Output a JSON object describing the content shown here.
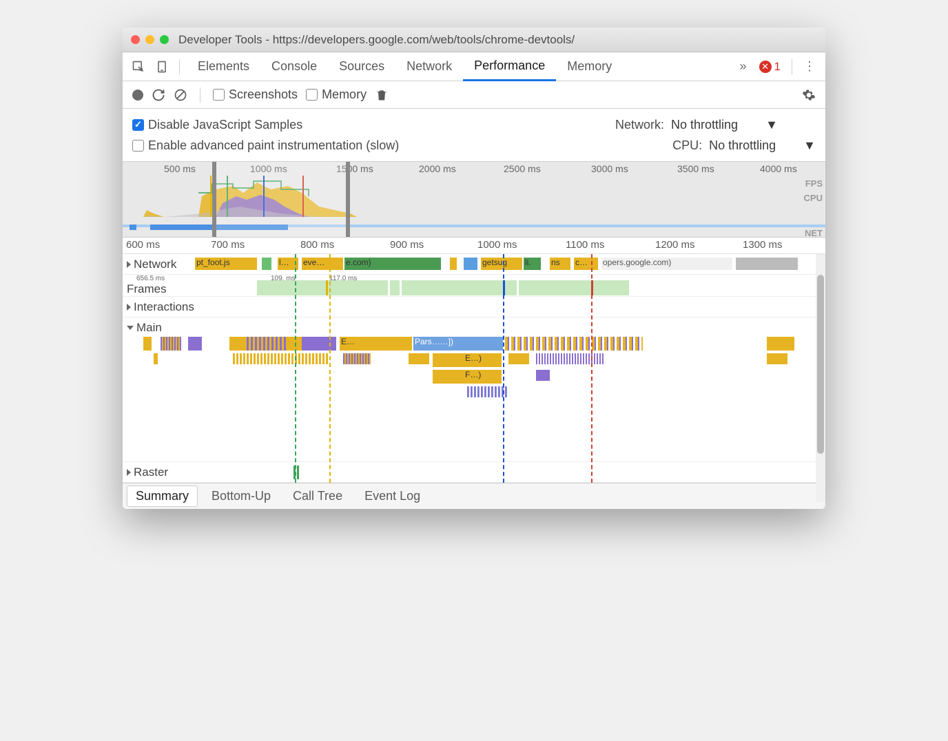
{
  "window": {
    "title": "Developer Tools - https://developers.google.com/web/tools/chrome-devtools/"
  },
  "tabs": {
    "items": [
      "Elements",
      "Console",
      "Sources",
      "Network",
      "Performance",
      "Memory"
    ],
    "active": "Performance",
    "overflow": "»",
    "errors": "1"
  },
  "toolbar": {
    "screenshots": "Screenshots",
    "memory": "Memory"
  },
  "settings": {
    "disable_js": "Disable JavaScript Samples",
    "enable_paint": "Enable advanced paint instrumentation (slow)",
    "network_lbl": "Network:",
    "network_val": "No throttling",
    "cpu_lbl": "CPU:",
    "cpu_val": "No throttling"
  },
  "overview": {
    "ticks": [
      "500 ms",
      "1000 ms",
      "1500 ms",
      "2000 ms",
      "2500 ms",
      "3000 ms",
      "3500 ms",
      "4000 ms"
    ],
    "labels": {
      "fps": "FPS",
      "cpu": "CPU",
      "net": "NET"
    }
  },
  "ruler": [
    "600 ms",
    "700 ms",
    "800 ms",
    "900 ms",
    "1000 ms",
    "1100 ms",
    "1200 ms",
    "1300 ms"
  ],
  "tracks": {
    "network": "Network",
    "frames": "Frames",
    "interactions": "Interactions",
    "main": "Main",
    "raster": "Raster",
    "frame_ts1": "656.5 ms",
    "frame_ts2": "109. ms",
    "frame_ts3": "117.0 ms",
    "net1": "pt_foot.js",
    "net2": "l…",
    "net3": "eve…",
    "net4": "e.com)",
    "net5": "getsug",
    "net6": "li.",
    "net7": "ns",
    "net8": "c…",
    "net9": "opers.google.com)",
    "m1": "E…",
    "m2": "Pars……])",
    "m3": "E…)",
    "m4": "F…)"
  },
  "bottom": {
    "summary": "Summary",
    "bottomup": "Bottom-Up",
    "calltree": "Call Tree",
    "eventlog": "Event Log"
  }
}
